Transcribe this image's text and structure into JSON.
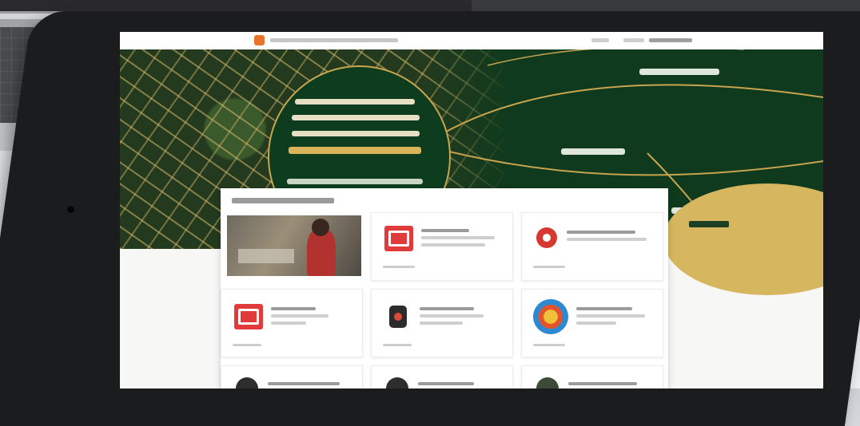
{
  "colors": {
    "hero_green": "#0f3a1d",
    "hero_gold": "#d6b65f",
    "brand_orange": "#e8742a",
    "service_red": "#e03a3a"
  },
  "browser": {
    "site_logo_icon": "emblem-icon",
    "site_title": "",
    "nav": [
      "",
      "",
      ""
    ]
  },
  "hero": {
    "headline_lines": [
      "",
      "",
      "",
      ""
    ],
    "cta_label": "",
    "labels": [
      "",
      "",
      "",
      ""
    ],
    "corner_label": ""
  },
  "services_panel": {
    "title": "",
    "cards": [
      {
        "icon": "photo",
        "title": "",
        "tag": ""
      },
      {
        "icon": "red-square-icon",
        "title": "",
        "tag": ""
      },
      {
        "icon": "red-circle-icon",
        "title": "",
        "tag": ""
      },
      {
        "icon": "red-square-icon",
        "title": "",
        "tag": ""
      },
      {
        "icon": "emblem-icon",
        "title": "",
        "tag": ""
      },
      {
        "icon": "round-logo-icon",
        "title": "",
        "tag": ""
      },
      {
        "icon": "dark-logo-icon",
        "title": "",
        "tag": ""
      },
      {
        "icon": "dark-logo-icon",
        "title": "",
        "tag": ""
      },
      {
        "icon": "dark-logo-icon",
        "title": "",
        "tag": ""
      }
    ]
  }
}
